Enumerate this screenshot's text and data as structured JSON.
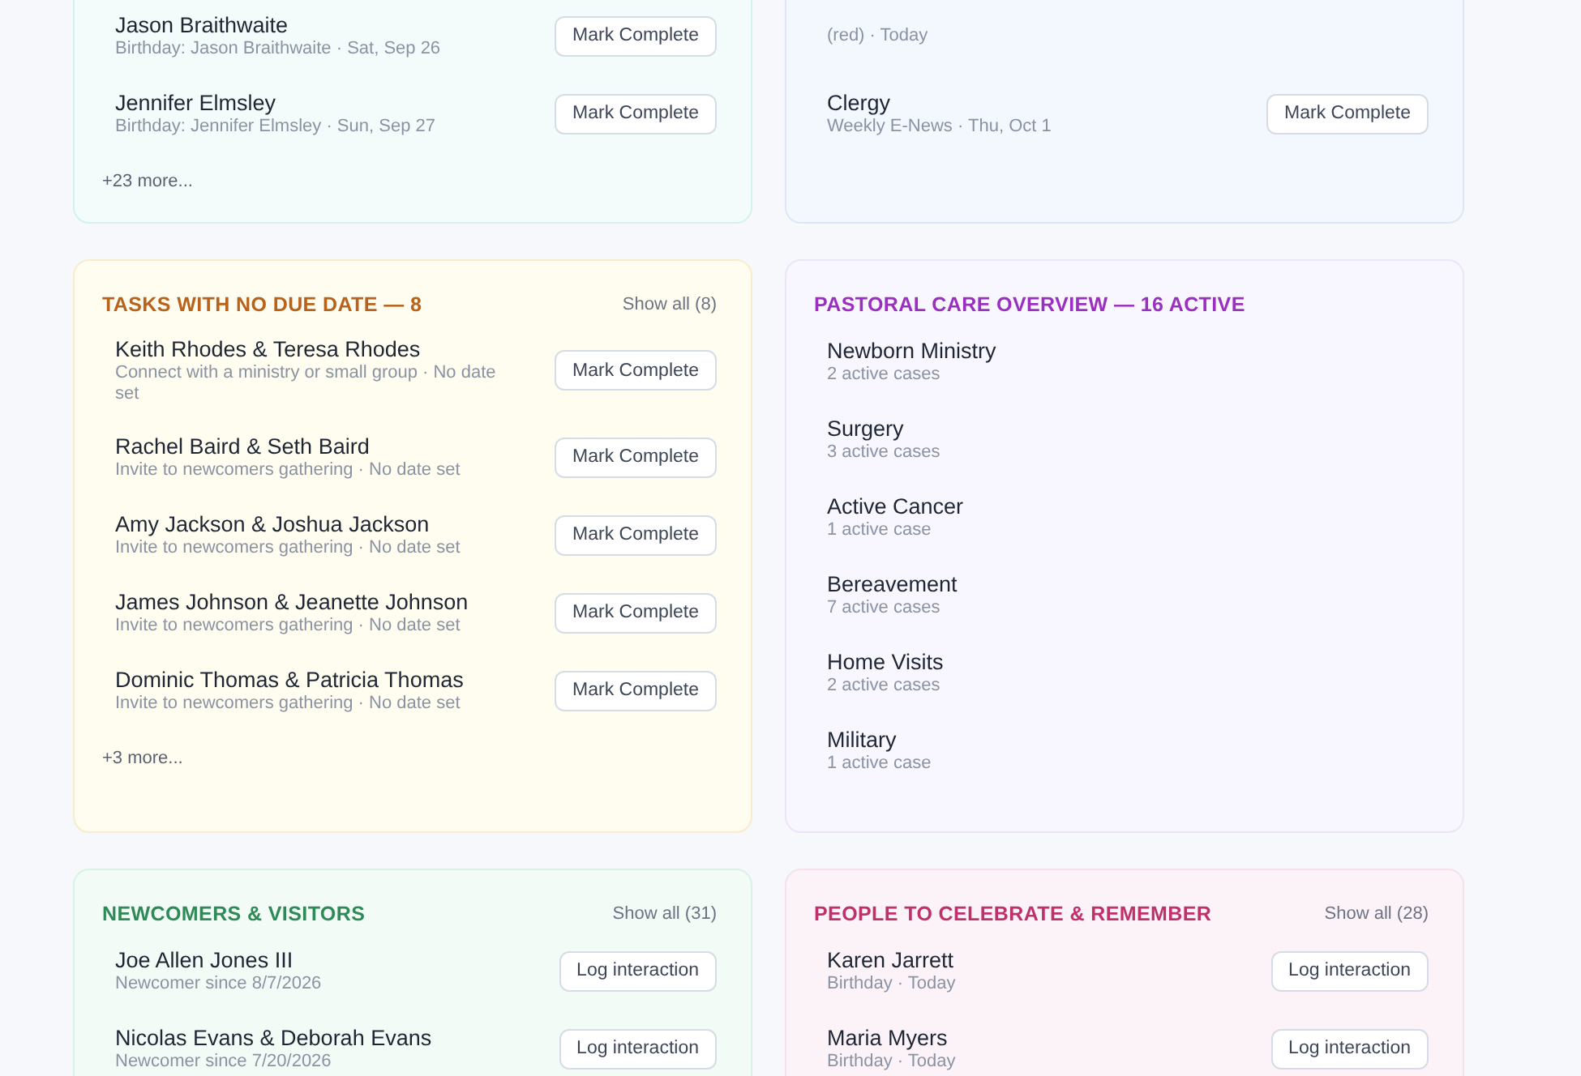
{
  "cards": [
    {
      "kind": "teal",
      "items": [
        {
          "name": "Jason Braithwaite",
          "detail": "Birthday: Jason Braithwaite · Sat, Sep 26",
          "action": "Mark Complete"
        },
        {
          "name": "Jennifer Elmsley",
          "detail": "Birthday: Jennifer Elmsley · Sun, Sep 27",
          "action": "Mark Complete"
        }
      ],
      "more": "+23 more..."
    },
    {
      "kind": "blue",
      "items": [
        {
          "detail": "(red) · Today"
        },
        {
          "name": "Clergy",
          "detail": "Weekly E-News · Thu, Oct 1",
          "action": "Mark Complete"
        }
      ]
    },
    {
      "kind": "amber",
      "title": "TASKS WITH NO DUE DATE — 8",
      "show_all": "Show all (8)",
      "items": [
        {
          "name": "Keith Rhodes & Teresa Rhodes",
          "detail": "Connect with a ministry or small group · No date set",
          "action": "Mark Complete"
        },
        {
          "name": "Rachel Baird & Seth Baird",
          "detail": "Invite to newcomers gathering · No date set",
          "action": "Mark Complete"
        },
        {
          "name": "Amy Jackson & Joshua Jackson",
          "detail": "Invite to newcomers gathering · No date set",
          "action": "Mark Complete"
        },
        {
          "name": "James Johnson & Jeanette Johnson",
          "detail": "Invite to newcomers gathering · No date set",
          "action": "Mark Complete"
        },
        {
          "name": "Dominic Thomas & Patricia Thomas",
          "detail": "Invite to newcomers gathering · No date set",
          "action": "Mark Complete"
        }
      ],
      "more": "+3 more..."
    },
    {
      "kind": "violet",
      "title": "PASTORAL CARE OVERVIEW — 16 ACTIVE",
      "items": [
        {
          "name": "Newborn Ministry",
          "detail": "2 active cases"
        },
        {
          "name": "Surgery",
          "detail": "3 active cases"
        },
        {
          "name": "Active Cancer",
          "detail": "1 active case"
        },
        {
          "name": "Bereavement",
          "detail": "7 active cases"
        },
        {
          "name": "Home Visits",
          "detail": "2 active cases"
        },
        {
          "name": "Military",
          "detail": "1 active case"
        }
      ]
    },
    {
      "kind": "green",
      "title": "NEWCOMERS & VISITORS",
      "show_all": "Show all (31)",
      "items": [
        {
          "name": "Joe Allen Jones III",
          "detail": "Newcomer since 8/7/2026",
          "action": "Log interaction"
        },
        {
          "name": "Nicolas Evans & Deborah Evans",
          "detail": "Newcomer since 7/20/2026",
          "action": "Log interaction"
        }
      ]
    },
    {
      "kind": "rose",
      "title": "PEOPLE TO CELEBRATE & REMEMBER",
      "show_all": "Show all (28)",
      "items": [
        {
          "name": "Karen Jarrett",
          "detail": "Birthday · Today",
          "action": "Log interaction"
        },
        {
          "name": "Maria Myers",
          "detail": "Birthday · Today",
          "action": "Log interaction"
        }
      ]
    }
  ]
}
